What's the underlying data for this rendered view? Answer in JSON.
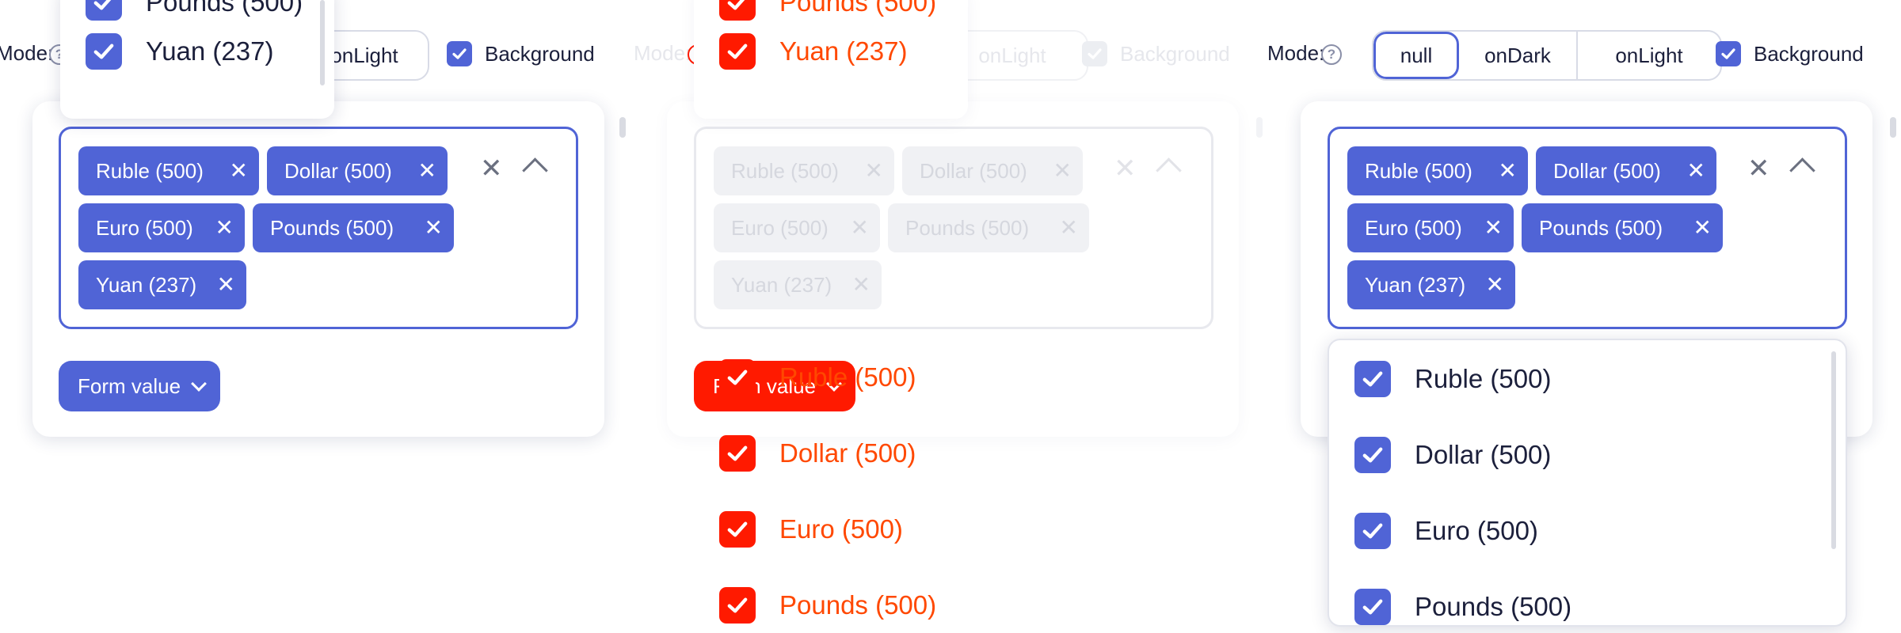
{
  "toolbar": {
    "mode_label": "Mode:",
    "help_icon": "?",
    "segments": [
      "null",
      "onDark",
      "onLight"
    ],
    "background_label": "Background"
  },
  "tags": [
    {
      "label": "Ruble (500)"
    },
    {
      "label": "Dollar (500)"
    },
    {
      "label": "Euro (500)"
    },
    {
      "label": "Pounds (500)"
    },
    {
      "label": "Yuan (237)"
    }
  ],
  "tag_remove_glyph": "✕",
  "clear_glyph": "✕",
  "form_button": "Form value",
  "options": [
    "Ruble (500)",
    "Dollar (500)",
    "Euro (500)",
    "Pounds (500)",
    "Yuan (237)"
  ],
  "colors": {
    "accent": "#5064d6",
    "debug_red": "#ff1a00",
    "disabled": "#f0f1f4"
  }
}
